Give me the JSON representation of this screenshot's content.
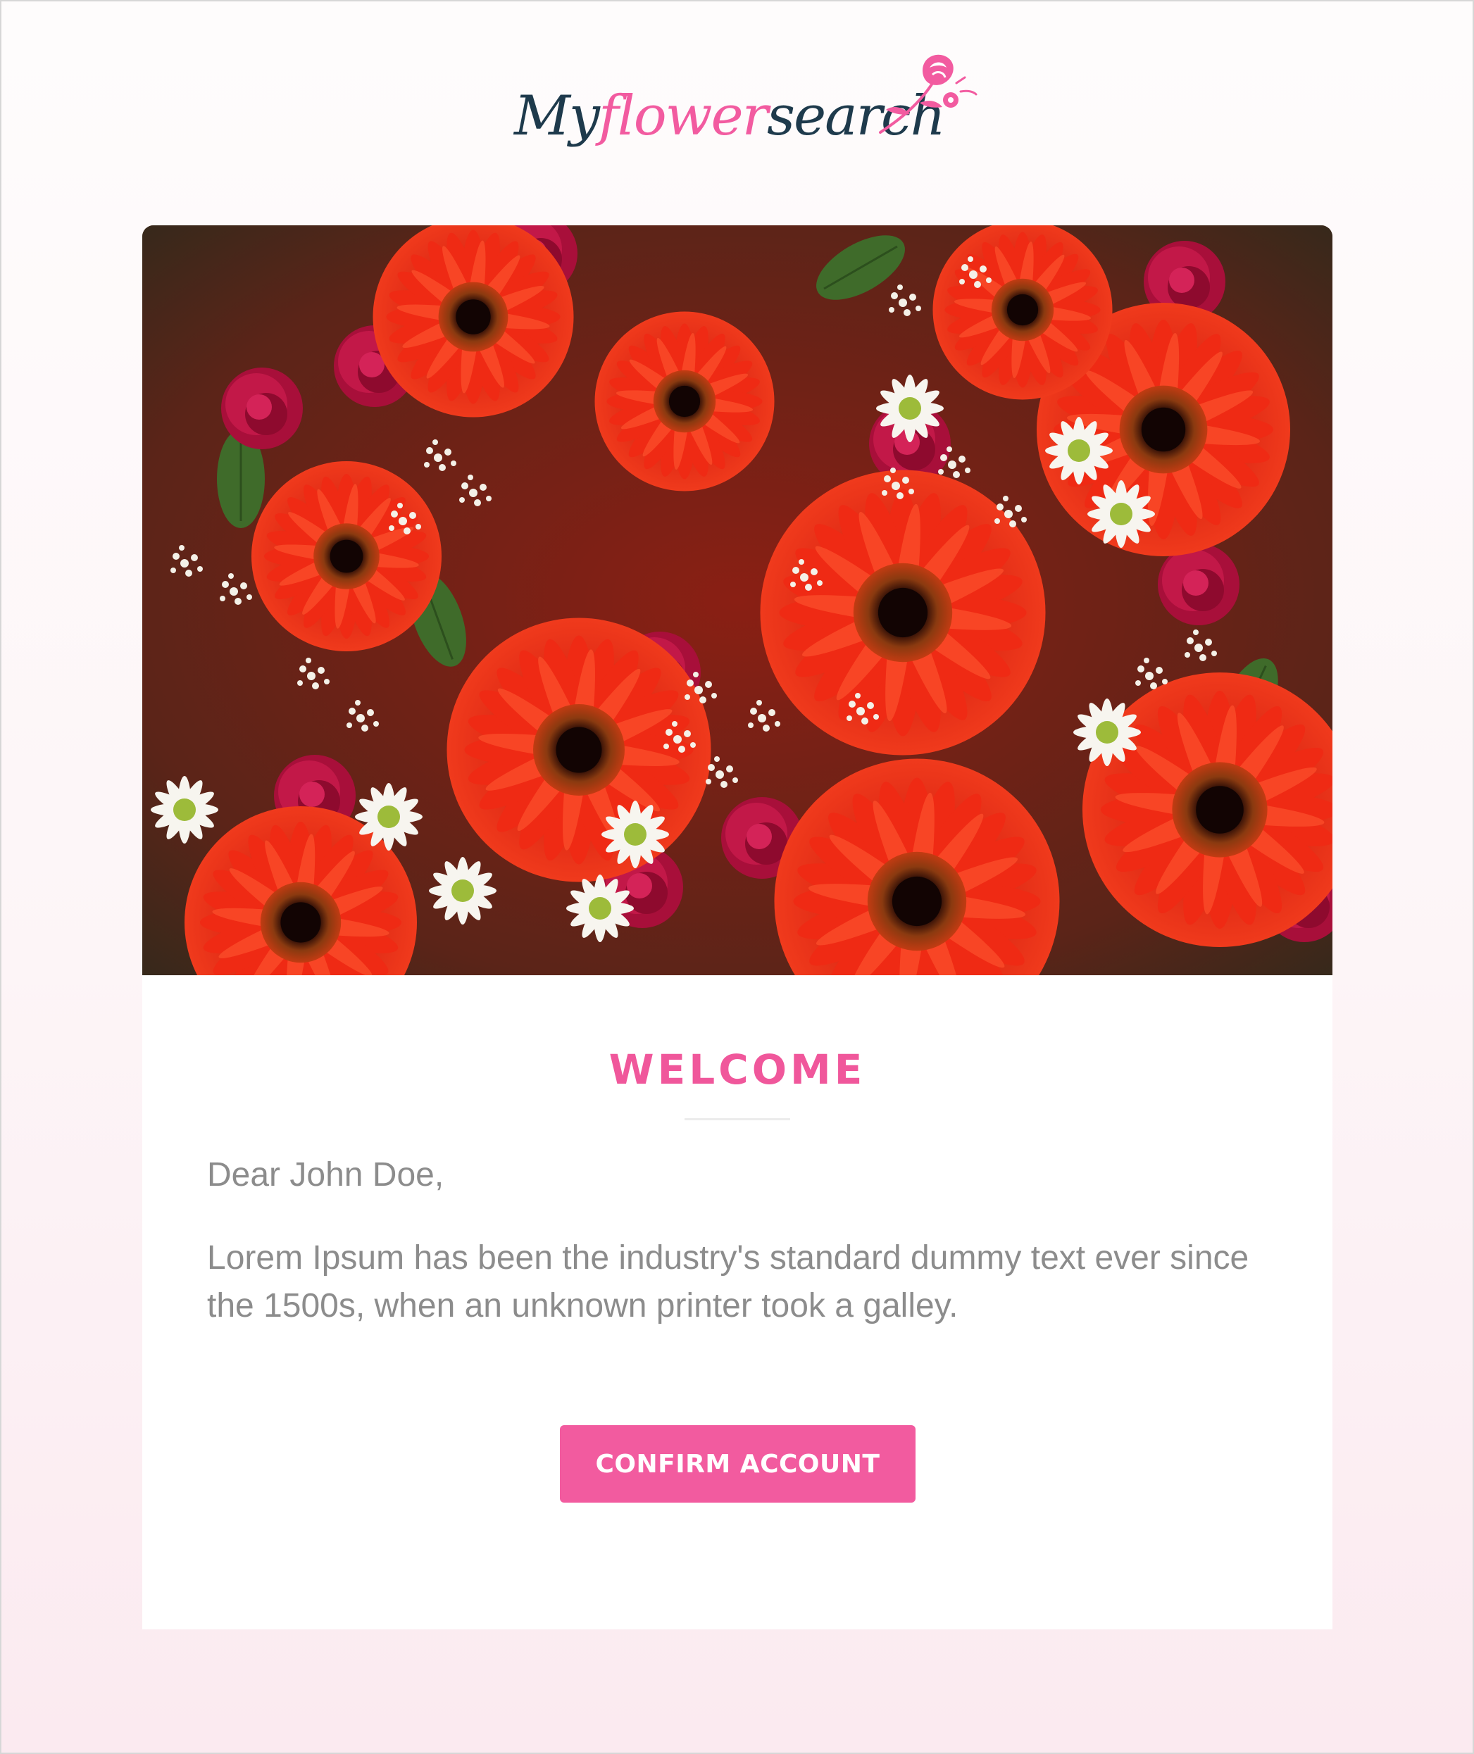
{
  "brand": {
    "logo_dark_1": "My",
    "logo_pink": "flower",
    "logo_dark_2": "search"
  },
  "hero": {
    "icon": "flower-bouquet-photo"
  },
  "email": {
    "title": "WELCOME",
    "greeting": "Dear John Doe,",
    "body": "Lorem Ipsum has been the industry's standard dummy text ever since the 1500s, when an unknown printer took a galley.",
    "cta_label": "CONFIRM ACCOUNT"
  },
  "colors": {
    "accent": "#f25b9f",
    "logo_dark": "#1e3a4c",
    "text_gray": "#8c8c8c",
    "page_background": "#fdf5f7"
  }
}
